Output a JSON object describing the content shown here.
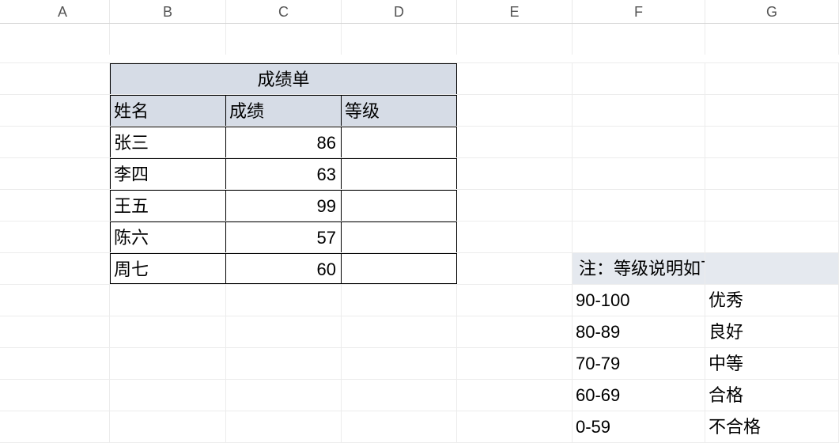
{
  "columns": [
    "A",
    "B",
    "C",
    "D",
    "E",
    "F",
    "G"
  ],
  "title_cell": "成绩单",
  "headers": {
    "name": "姓名",
    "score": "成绩",
    "grade": "等级"
  },
  "students": [
    {
      "name": "张三",
      "score": 86,
      "grade": ""
    },
    {
      "name": "李四",
      "score": 63,
      "grade": ""
    },
    {
      "name": "王五",
      "score": 99,
      "grade": ""
    },
    {
      "name": "陈六",
      "score": 57,
      "grade": ""
    },
    {
      "name": "周七",
      "score": 60,
      "grade": ""
    }
  ],
  "note": {
    "title": "注：等级说明如下："
  },
  "legend": [
    {
      "range": "90-100",
      "label": "优秀"
    },
    {
      "range": "80-89",
      "label": "良好"
    },
    {
      "range": "70-79",
      "label": "中等"
    },
    {
      "range": "60-69",
      "label": "合格"
    },
    {
      "range": "0-59",
      "label": "不合格"
    }
  ],
  "chart_data": {
    "type": "table",
    "title": "成绩单",
    "columns": [
      "姓名",
      "成绩",
      "等级"
    ],
    "rows": [
      [
        "张三",
        86,
        ""
      ],
      [
        "李四",
        63,
        ""
      ],
      [
        "王五",
        99,
        ""
      ],
      [
        "陈六",
        57,
        ""
      ],
      [
        "周七",
        60,
        ""
      ]
    ],
    "legend": [
      {
        "range": "90-100",
        "label": "优秀"
      },
      {
        "range": "80-89",
        "label": "良好"
      },
      {
        "range": "70-79",
        "label": "中等"
      },
      {
        "range": "60-69",
        "label": "合格"
      },
      {
        "range": "0-59",
        "label": "不合格"
      }
    ]
  }
}
